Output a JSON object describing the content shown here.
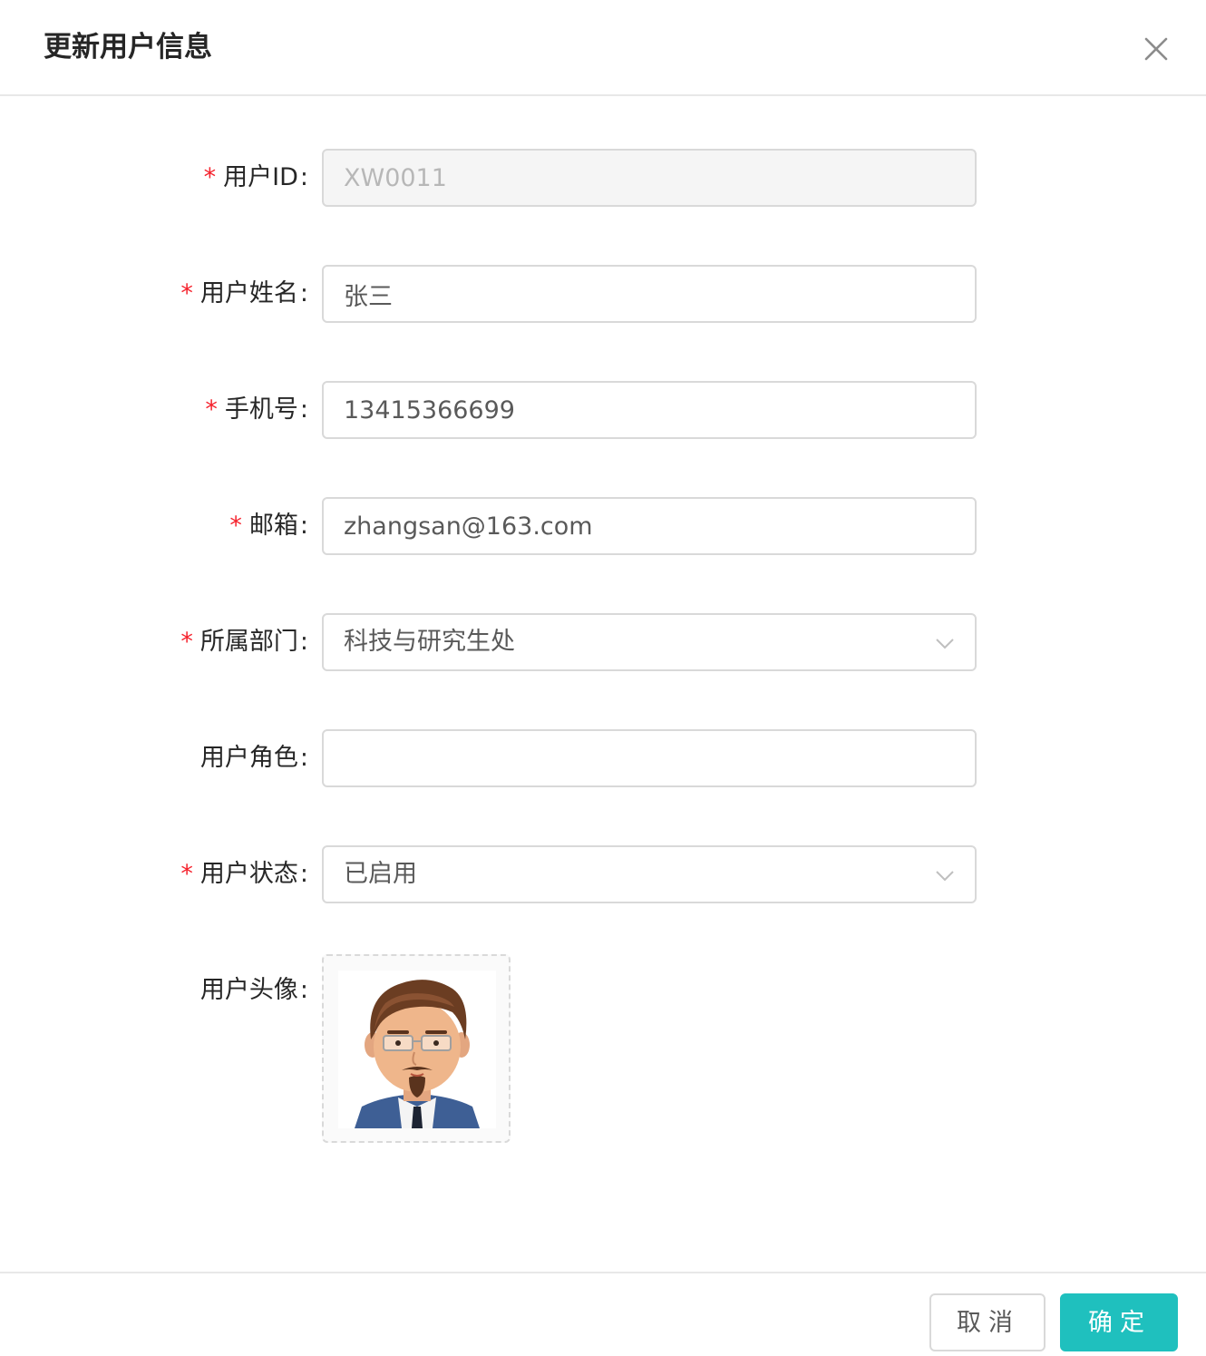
{
  "modal": {
    "title": "更新用户信息",
    "close_icon": "close-icon"
  },
  "form": {
    "user_id": {
      "label": "用户ID",
      "required": true,
      "value": "XW0011",
      "disabled": true
    },
    "user_name": {
      "label": "用户姓名",
      "required": true,
      "value": "张三"
    },
    "phone": {
      "label": "手机号",
      "required": true,
      "value": "13415366699"
    },
    "email": {
      "label": "邮箱",
      "required": true,
      "value": "zhangsan@163.com"
    },
    "department": {
      "label": "所属部门",
      "required": true,
      "value": "科技与研究生处",
      "icon": "chevron-down-icon"
    },
    "role": {
      "label": "用户角色",
      "required": false,
      "value": ""
    },
    "status": {
      "label": "用户状态",
      "required": true,
      "value": "已启用",
      "icon": "chevron-down-icon"
    },
    "avatar": {
      "label": "用户头像",
      "required": false,
      "image": "cartoon-man-avatar"
    }
  },
  "footer": {
    "cancel_label": "取消",
    "ok_label": "确定"
  },
  "colors": {
    "primary": "#1fc0be",
    "required": "#f5222d",
    "border": "#d9d9d9"
  }
}
